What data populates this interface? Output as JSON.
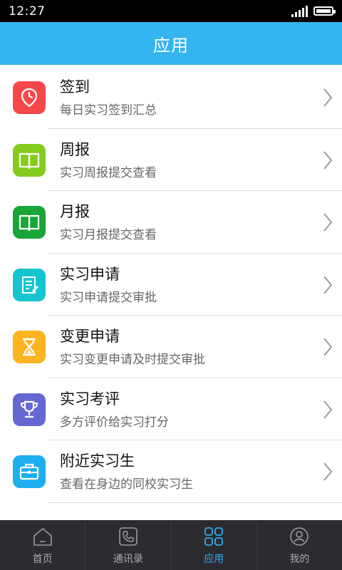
{
  "status_bar": {
    "time": "12:27"
  },
  "header": {
    "title": "应用"
  },
  "list": [
    {
      "title": "签到",
      "subtitle": "每日实习签到汇总",
      "icon": "location-clock-icon",
      "color": "#f5484b"
    },
    {
      "title": "周报",
      "subtitle": "实习周报提交查看",
      "icon": "book-icon",
      "color": "#86cc1f"
    },
    {
      "title": "月报",
      "subtitle": "实习月报提交查看",
      "icon": "book-icon",
      "color": "#1aa538"
    },
    {
      "title": "实习申请",
      "subtitle": "实习申请提交审批",
      "icon": "document-edit-icon",
      "color": "#14c5d0"
    },
    {
      "title": "变更申请",
      "subtitle": "实习变更申请及时提交审批",
      "icon": "hourglass-icon",
      "color": "#fcb421"
    },
    {
      "title": "实习考评",
      "subtitle": "多方评价给实习打分",
      "icon": "trophy-icon",
      "color": "#6567d3"
    },
    {
      "title": "附近实习生",
      "subtitle": "查看在身边的同校实习生",
      "icon": "briefcase-icon",
      "color": "#1daef0"
    }
  ],
  "tabbar": [
    {
      "label": "首页",
      "icon": "home-icon",
      "active": false
    },
    {
      "label": "通讯录",
      "icon": "phone-icon",
      "active": false
    },
    {
      "label": "应用",
      "icon": "apps-icon",
      "active": true
    },
    {
      "label": "我的",
      "icon": "user-icon",
      "active": false
    }
  ],
  "colors": {
    "header": "#34b4f0",
    "tab_active": "#2fa9ef",
    "tab_inactive": "#a9a9a9",
    "tabbar_bg": "#2c2c30"
  }
}
